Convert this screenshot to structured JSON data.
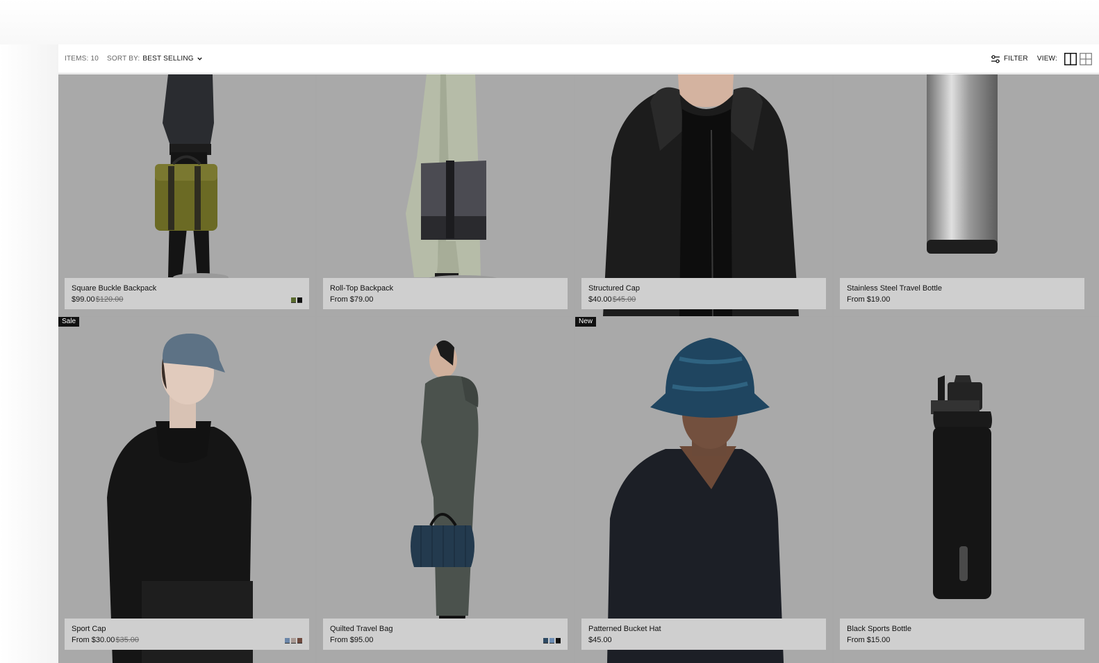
{
  "toolbar": {
    "items_label": "ITEMS: 10",
    "sort_label": "SORT BY:",
    "sort_value": "BEST SELLING",
    "filter_label": "FILTER",
    "view_label": "VIEW:"
  },
  "products": [
    {
      "name": "Square Buckle Backpack",
      "price": "$99.00",
      "compare_price": "$120.00",
      "badge": "",
      "swatches": [
        "#5a6b2f",
        "#111111"
      ],
      "image": "olive-backpack"
    },
    {
      "name": "Roll-Top Backpack",
      "price": "From $79.00",
      "compare_price": "",
      "badge": "",
      "swatches": [],
      "image": "grey-rolltop-backpack"
    },
    {
      "name": "Structured Cap",
      "price": "$40.00",
      "compare_price": "$45.00",
      "badge": "",
      "swatches": [],
      "image": "black-jacket-model"
    },
    {
      "name": "Stainless Steel Travel Bottle",
      "price": "From $19.00",
      "compare_price": "",
      "badge": "",
      "swatches": [],
      "image": "steel-bottle"
    },
    {
      "name": "Sport Cap",
      "price": "From $30.00",
      "compare_price": "$35.00",
      "badge": "Sale",
      "swatches": [
        "#6b86a8",
        "#a99a94",
        "#6e4a3e"
      ],
      "image": "blue-cap-model"
    },
    {
      "name": "Quilted Travel Bag",
      "price": "From $95.00",
      "compare_price": "",
      "badge": "",
      "swatches": [
        "#2f4a63",
        "#6d8db3",
        "#111111"
      ],
      "image": "quilted-bag-model"
    },
    {
      "name": "Patterned Bucket Hat",
      "price": "$45.00",
      "compare_price": "",
      "badge": "New",
      "swatches": [],
      "image": "bucket-hat-model"
    },
    {
      "name": "Black Sports Bottle",
      "price": "From $15.00",
      "compare_price": "",
      "badge": "",
      "swatches": [],
      "image": "black-bottle"
    }
  ],
  "colors": {
    "tile_background": "#a9a9a9",
    "info_panel": "#cfcfcf",
    "badge": "#111111"
  }
}
